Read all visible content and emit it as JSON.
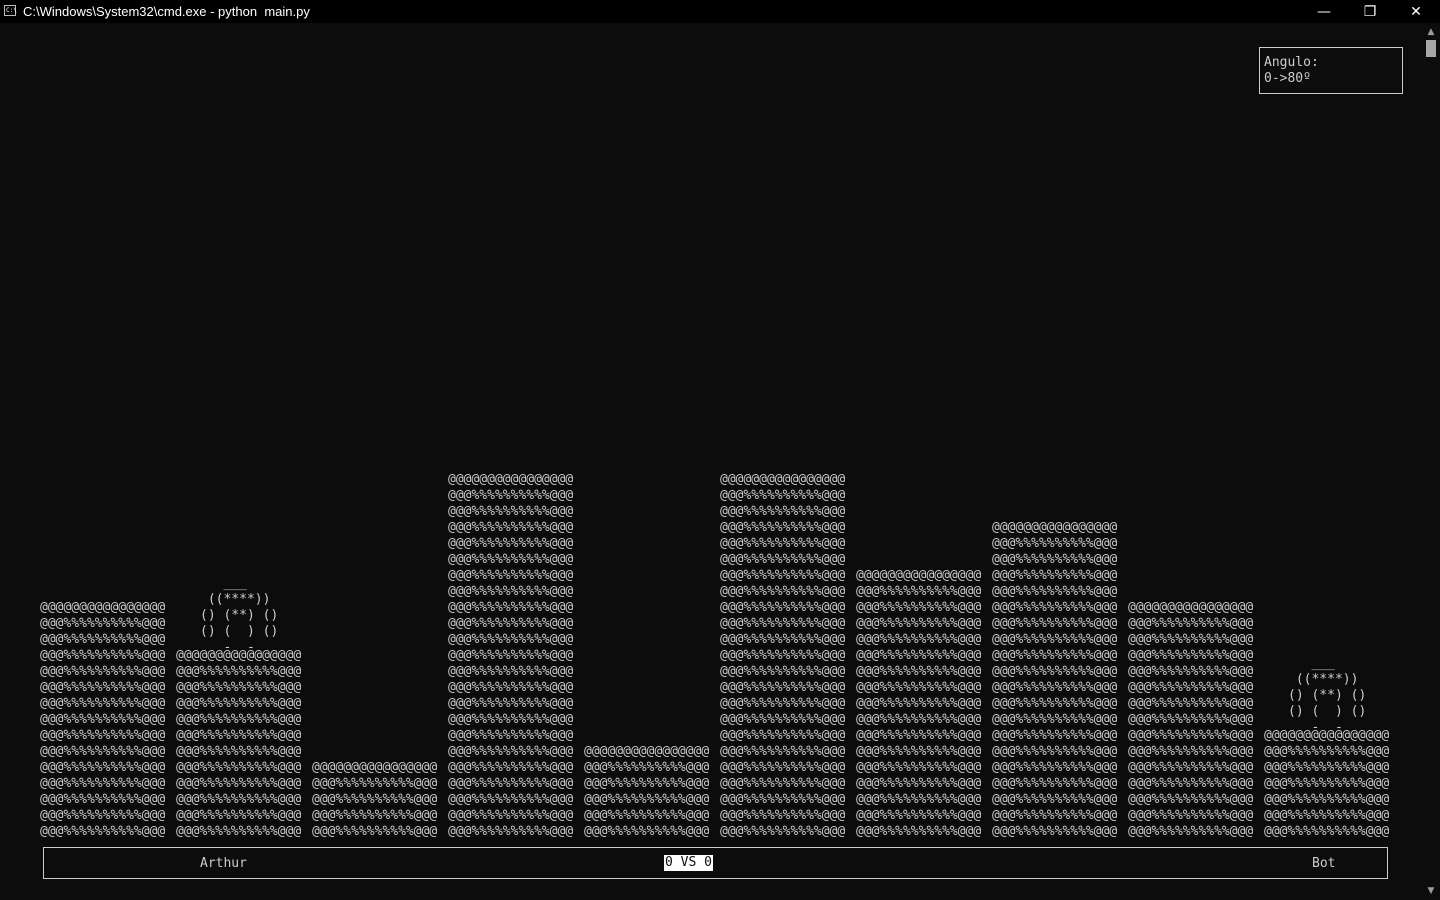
{
  "window": {
    "title": "C:\\Windows\\System32\\cmd.exe - python  main.py",
    "icon_text": "C:\\",
    "minimize_glyph": "—",
    "maximize_glyph": "❐",
    "close_glyph": "✕"
  },
  "hud": {
    "angle_label": "Angulo:",
    "angle_value": "0->80º"
  },
  "scoreboard": {
    "player1": "Arthur",
    "score": "0 VS 0",
    "player2": "Bot"
  },
  "art": {
    "building_top": "@@@@@@@@@@@@@@@@",
    "building_body": "@@@%%%%%%%%%%@@@",
    "player_sprite": "   ___\n ((****))\n() (**) ()\n() (  ) ()\n   -  -"
  },
  "buildings": [
    {
      "id": "b1",
      "rows": 15
    },
    {
      "id": "b2",
      "rows": 12
    },
    {
      "id": "b3",
      "rows": 5
    },
    {
      "id": "b4",
      "rows": 23
    },
    {
      "id": "b5",
      "rows": 6
    },
    {
      "id": "b6",
      "rows": 23
    },
    {
      "id": "b7",
      "rows": 17
    },
    {
      "id": "b8",
      "rows": 20
    },
    {
      "id": "b9",
      "rows": 15
    },
    {
      "id": "b10",
      "rows": 7
    }
  ],
  "scrollbar": {
    "up_arrow": "▲",
    "down_arrow": "▼"
  }
}
